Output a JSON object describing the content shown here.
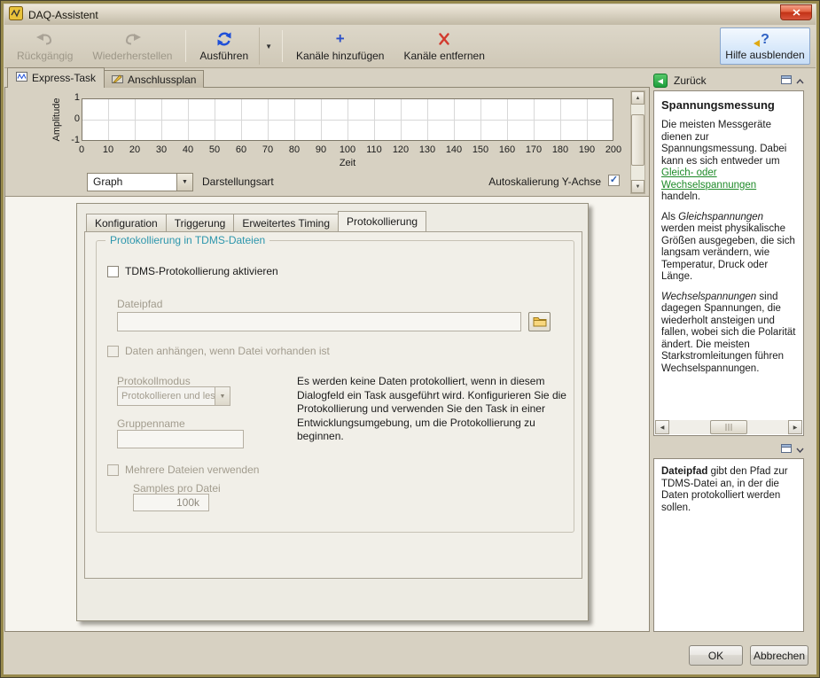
{
  "window": {
    "title": "DAQ-Assistent"
  },
  "toolbar": {
    "undo": "Rückgängig",
    "redo": "Wiederherstellen",
    "run": "Ausführen",
    "add_channels": "Kanäle hinzufügen",
    "remove_channels": "Kanäle entfernen",
    "hide_help": "Hilfe ausblenden"
  },
  "main_tabs": {
    "express": "Express-Task",
    "wiring": "Anschlussplan"
  },
  "graph": {
    "ylabel": "Amplitude",
    "xlabel": "Zeit",
    "yticks": [
      "1",
      "0",
      "-1"
    ],
    "xticks": [
      "0",
      "10",
      "20",
      "30",
      "40",
      "50",
      "60",
      "70",
      "80",
      "90",
      "100",
      "110",
      "120",
      "130",
      "140",
      "150",
      "160",
      "170",
      "180",
      "190",
      "200"
    ],
    "display_combo_value": "Graph",
    "display_label": "Darstellungsart",
    "autoscale_label": "Autoskalierung Y-Achse",
    "autoscale_check_glyph": "✓"
  },
  "dialog": {
    "tabs": [
      "Konfiguration",
      "Triggerung",
      "Erweitertes Timing",
      "Protokollierung"
    ],
    "group_title": "Protokollierung in TDMS-Dateien",
    "enable_logging_label": "TDMS-Protokollierung aktivieren",
    "filepath_label": "Dateipfad",
    "append_label": "Daten anhängen, wenn Datei vorhanden ist",
    "logmode_label": "Protokollmodus",
    "logmode_value": "Protokollieren und lesen",
    "groupname_label": "Gruppenname",
    "multifile_label": "Mehrere Dateien verwenden",
    "samples_label": "Samples pro Datei",
    "samples_value": "100k",
    "info_text": "Es werden keine Daten protokolliert, wenn in diesem Dialogfeld ein Task ausgeführt wird. Konfigurieren Sie die Protokollierung und verwenden Sie den Task in einer Entwicklungsumgebung, um die Protokollierung zu beginnen."
  },
  "help": {
    "back_label": "Zurück",
    "title": "Spannungsmessung",
    "p1_before": "Die meisten Messgeräte dienen zur Spannungsmessung. Dabei kann es sich entweder um ",
    "p1_link": "Gleich- oder Wechselspannungen",
    "p1_after": " handeln.",
    "p2_lead": "Als ",
    "p2_italic": "Gleichspannungen",
    "p2_rest": " werden meist physikalische Größen ausgegeben, die sich langsam verändern, wie Temperatur, Druck oder Länge.",
    "p3_italic": "Wechselspannungen",
    "p3_rest": " sind dagegen Spannungen, die wiederholt ansteigen und fallen, wobei sich die Polarität ändert. Die meisten Starkstromleitungen führen Wechselspannungen.",
    "tip_term": "Dateipfad",
    "tip_rest": " gibt den Pfad zur TDMS-Datei an, in der die Daten protokolliert werden sollen."
  },
  "footer": {
    "ok": "OK",
    "cancel": "Abbrechen"
  }
}
